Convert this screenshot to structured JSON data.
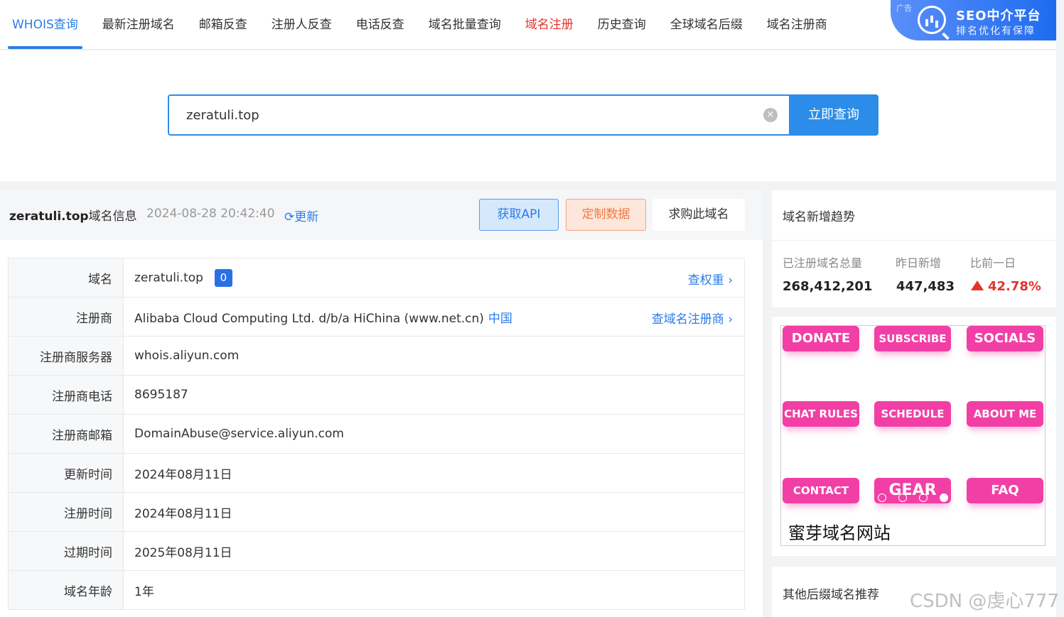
{
  "nav": {
    "items": [
      "WHOIS查询",
      "最新注册域名",
      "邮箱反查",
      "注册人反查",
      "电话反查",
      "域名批量查询",
      "域名注册",
      "历史查询",
      "全球域名后缀",
      "域名注册商"
    ]
  },
  "ad": {
    "tag": "广告",
    "title": "SEO中介平台",
    "subtitle": "排名优化有保障"
  },
  "search": {
    "value": "zeratuli.top",
    "clear_icon": "×",
    "button": "立即查询"
  },
  "domain_header": {
    "domain": "zeratuli.top",
    "suffix": "域名信息",
    "timestamp": "2024-08-28 20:42:40",
    "refresh_icon": "⟳",
    "refresh_label": "更新",
    "api_button": "获取API",
    "custom_button": "定制数据",
    "buy_button": "求购此域名"
  },
  "whois": {
    "rows": [
      {
        "label": "域名",
        "value": "zeratuli.top",
        "badge": "0",
        "link": "查权重 ›"
      },
      {
        "label": "注册商",
        "value": "Alibaba Cloud Computing Ltd. d/b/a HiChina (www.net.cn)",
        "extra": "中国",
        "link": "查域名注册商 ›"
      },
      {
        "label": "注册商服务器",
        "value": "whois.aliyun.com"
      },
      {
        "label": "注册商电话",
        "value": "8695187"
      },
      {
        "label": "注册商邮箱",
        "value": "DomainAbuse@service.aliyun.com"
      },
      {
        "label": "更新时间",
        "value": "2024年08月11日"
      },
      {
        "label": "注册时间",
        "value": "2024年08月11日"
      },
      {
        "label": "过期时间",
        "value": "2025年08月11日"
      },
      {
        "label": "域名年龄",
        "value": "1年"
      }
    ]
  },
  "trend": {
    "title": "域名新增趋势",
    "total_label": "已注册域名总量",
    "total_value": "268,412,201",
    "new_label": "昨日新增",
    "new_value": "447,483",
    "compare_label": "比前一日",
    "compare_value": "42.78%"
  },
  "banner": {
    "buttons": [
      "DONATE",
      "SUBSCRIBE",
      "SOCIALS",
      "CHAT RULES",
      "SCHEDULE",
      "ABOUT ME",
      "CONTACT",
      "GEAR",
      "FAQ"
    ],
    "active_dot": 3,
    "caption": "蜜芽域名网站"
  },
  "other": {
    "title": "其他后缀域名推荐"
  },
  "watermark": "CSDN @虔心777",
  "colors": {
    "accent": "#2b7de9",
    "danger": "#e5322d",
    "pink": "#f23fa6"
  }
}
